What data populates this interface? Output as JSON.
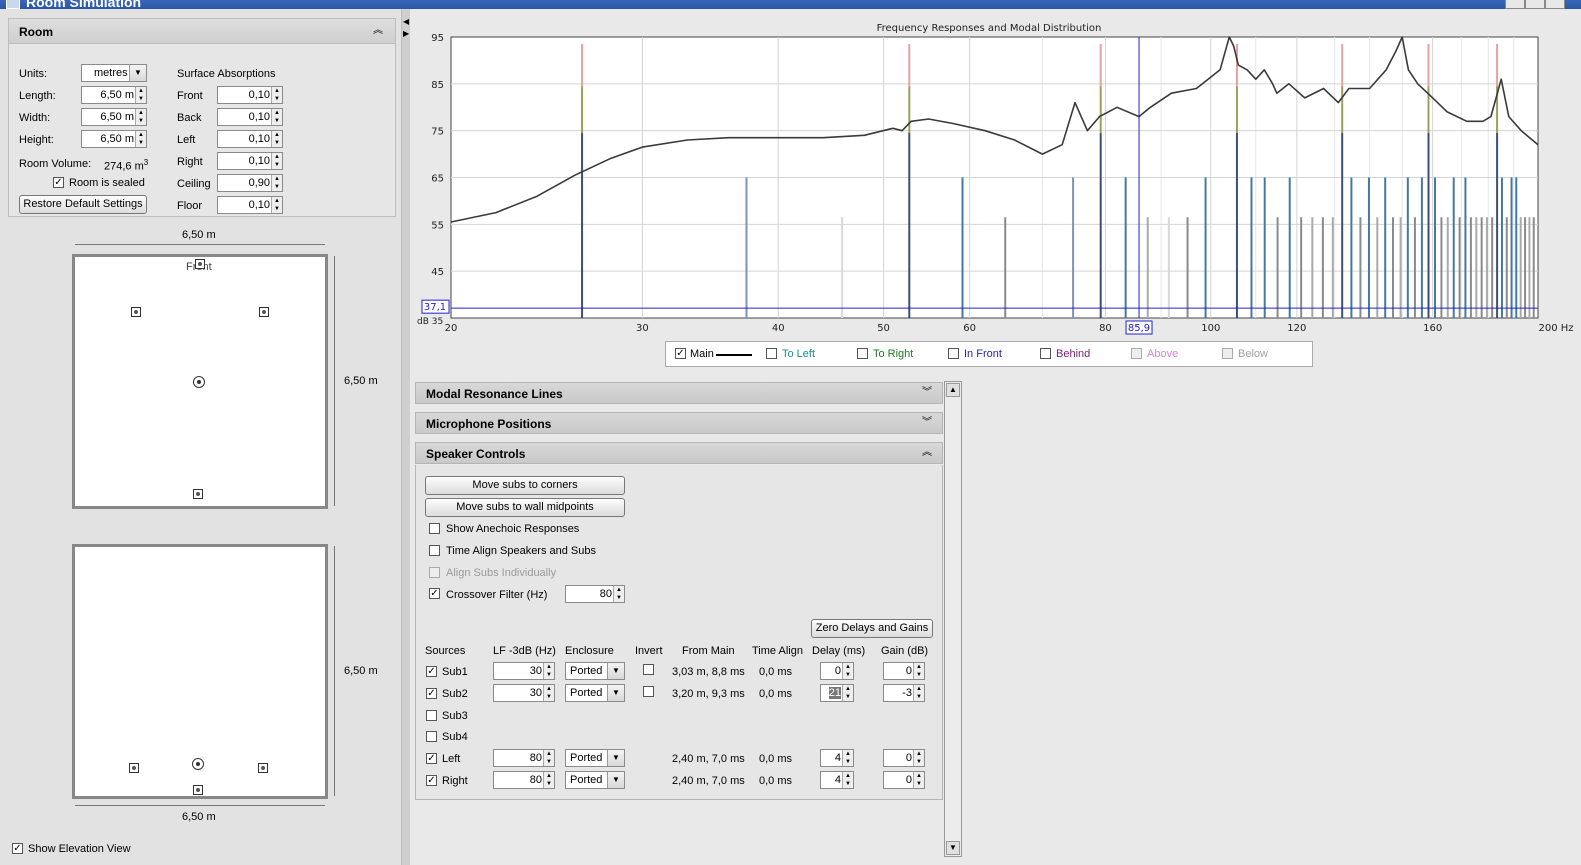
{
  "window": {
    "title": "Room Simulation"
  },
  "room": {
    "header": "Room",
    "units_label": "Units:",
    "units_value": "metres",
    "length_label": "Length:",
    "length_value": "6,50 m",
    "width_label": "Width:",
    "width_value": "6,50 m",
    "height_label": "Height:",
    "height_value": "6,50 m",
    "volume_label": "Room Volume:",
    "volume_value": "274,6 m",
    "volume_sup": "3",
    "sealed_label": "Room is sealed",
    "sealed_checked": "✓",
    "restore_button": "Restore Default Settings",
    "absorptions_header": "Surface Absorptions",
    "absorptions": [
      {
        "label": "Front",
        "value": "0,10"
      },
      {
        "label": "Back",
        "value": "0,10"
      },
      {
        "label": "Left",
        "value": "0,10"
      },
      {
        "label": "Right",
        "value": "0,10"
      },
      {
        "label": "Ceiling",
        "value": "0,90"
      },
      {
        "label": "Floor",
        "value": "0,10"
      }
    ]
  },
  "plan_view": {
    "width_dim": "6,50 m",
    "depth_dim": "6,50 m",
    "front_label": "Front"
  },
  "elevation_view": {
    "height_dim": "6,50 m",
    "width_dim": "6,50 m"
  },
  "show_elevation": {
    "label": "Show Elevation View",
    "checked": "✓"
  },
  "chart_data": {
    "type": "line",
    "title": "Frequency Responses and Modal Distribution",
    "xscale": "log",
    "xlim": [
      20,
      200
    ],
    "ylim": [
      35,
      95
    ],
    "xticks": [
      "20",
      "30",
      "40",
      "50",
      "60",
      "80",
      "100",
      "120",
      "160",
      "200 Hz"
    ],
    "yticks": [
      "95",
      "85",
      "75",
      "65",
      "55",
      "45"
    ],
    "ylabel": "dB 35",
    "cursor": {
      "x": "85,9",
      "y": "37,1"
    },
    "series": [
      {
        "name": "Main",
        "x": [
          20,
          22,
          24,
          26,
          28,
          30,
          33,
          36,
          40,
          44,
          48,
          51,
          52,
          53,
          55,
          58,
          62,
          66,
          70,
          73,
          75,
          77,
          79,
          82,
          85.9,
          88,
          92,
          97,
          102,
          104,
          105,
          106,
          108,
          110,
          112,
          114,
          115,
          118,
          122,
          127,
          131,
          134,
          140,
          145,
          148,
          150,
          152,
          155,
          160,
          165,
          172,
          178,
          181,
          183,
          185,
          188,
          193,
          200
        ],
        "y": [
          55.5,
          57.5,
          61,
          65.5,
          69,
          71.5,
          73,
          73.5,
          73.5,
          73.5,
          74,
          75.5,
          75,
          77,
          77.5,
          76.5,
          75,
          73,
          70,
          72,
          81,
          75,
          78,
          80,
          78,
          80,
          83,
          84,
          88,
          95,
          93,
          89,
          88,
          86,
          88,
          85,
          83,
          85,
          82,
          84,
          81,
          84,
          84,
          88,
          92,
          96,
          88,
          85,
          82,
          79,
          77,
          77,
          78,
          82,
          86,
          78,
          75,
          72
        ]
      }
    ],
    "mode_lines": [
      {
        "f": 26.4,
        "level": 95,
        "color": "#3d4f74"
      },
      {
        "f": 37.4,
        "level": 65,
        "color": "#7d93b8"
      },
      {
        "f": 45.8,
        "level": 56.5,
        "color": "#d8d8d8"
      },
      {
        "f": 52.8,
        "level": 95,
        "color": "#3d4f74"
      },
      {
        "f": 59.1,
        "level": 65,
        "color": "#46799e"
      },
      {
        "f": 64.7,
        "level": 56.5,
        "color": "#8a8a8a"
      },
      {
        "f": 74.7,
        "level": 65,
        "color": "#7d93b8"
      },
      {
        "f": 79.2,
        "level": 95,
        "color": "#3d4f74"
      },
      {
        "f": 83.5,
        "level": 65,
        "color": "#46799e"
      },
      {
        "f": 87.5,
        "level": 56.5,
        "color": "#a9a9a9"
      },
      {
        "f": 91.5,
        "level": 56.5,
        "color": "#d8d8d8"
      },
      {
        "f": 95.2,
        "level": 56.5,
        "color": "#8a8a8a"
      },
      {
        "f": 98.9,
        "level": 65,
        "color": "#46799e"
      },
      {
        "f": 105.7,
        "level": 95,
        "color": "#3d4f74"
      },
      {
        "f": 109.0,
        "level": 65,
        "color": "#46799e"
      },
      {
        "f": 112.1,
        "level": 65,
        "color": "#46799e"
      },
      {
        "f": 115.2,
        "level": 56.5,
        "color": "#8a8a8a"
      },
      {
        "f": 118.2,
        "level": 65,
        "color": "#46799e"
      },
      {
        "f": 121.1,
        "level": 56.5,
        "color": "#8a8a8a"
      },
      {
        "f": 124.0,
        "level": 56.5,
        "color": "#a9a9a9"
      },
      {
        "f": 126.8,
        "level": 56.5,
        "color": "#8a8a8a"
      },
      {
        "f": 129.5,
        "level": 56.5,
        "color": "#a9a9a9"
      },
      {
        "f": 132.1,
        "level": 95,
        "color": "#3d4f74"
      },
      {
        "f": 134.7,
        "level": 65,
        "color": "#46799e"
      },
      {
        "f": 137.3,
        "level": 56.5,
        "color": "#8a8a8a"
      },
      {
        "f": 139.8,
        "level": 65,
        "color": "#46799e"
      },
      {
        "f": 142.3,
        "level": 56.5,
        "color": "#a9a9a9"
      },
      {
        "f": 144.7,
        "level": 65,
        "color": "#46799e"
      },
      {
        "f": 147.1,
        "level": 56.5,
        "color": "#8a8a8a"
      },
      {
        "f": 149.5,
        "level": 56.5,
        "color": "#a9a9a9"
      },
      {
        "f": 151.8,
        "level": 65,
        "color": "#46799e"
      },
      {
        "f": 154.1,
        "level": 56.5,
        "color": "#8a8a8a"
      },
      {
        "f": 156.4,
        "level": 65,
        "color": "#46799e"
      },
      {
        "f": 158.6,
        "level": 95,
        "color": "#3d4f74"
      },
      {
        "f": 160.8,
        "level": 65,
        "color": "#46799e"
      },
      {
        "f": 163.0,
        "level": 56.5,
        "color": "#8a8a8a"
      },
      {
        "f": 165.2,
        "level": 56.5,
        "color": "#a9a9a9"
      },
      {
        "f": 167.3,
        "level": 65,
        "color": "#46799e"
      },
      {
        "f": 169.4,
        "level": 56.5,
        "color": "#8a8a8a"
      },
      {
        "f": 171.5,
        "level": 65,
        "color": "#46799e"
      },
      {
        "f": 173.5,
        "level": 56.5,
        "color": "#8a8a8a"
      },
      {
        "f": 175.5,
        "level": 56.5,
        "color": "#a9a9a9"
      },
      {
        "f": 177.5,
        "level": 56.5,
        "color": "#8a8a8a"
      },
      {
        "f": 179.5,
        "level": 56.5,
        "color": "#a9a9a9"
      },
      {
        "f": 181.5,
        "level": 56.5,
        "color": "#8a8a8a"
      },
      {
        "f": 183.4,
        "level": 95,
        "color": "#3d4f74"
      },
      {
        "f": 185.3,
        "level": 65,
        "color": "#46799e"
      },
      {
        "f": 187.2,
        "level": 56.5,
        "color": "#8a8a8a"
      },
      {
        "f": 189.1,
        "level": 65,
        "color": "#46799e"
      },
      {
        "f": 191.0,
        "level": 65,
        "color": "#46799e"
      },
      {
        "f": 192.8,
        "level": 56.5,
        "color": "#a9a9a9"
      },
      {
        "f": 194.6,
        "level": 56.5,
        "color": "#8a8a8a"
      },
      {
        "f": 196.4,
        "level": 56.5,
        "color": "#a9a9a9"
      },
      {
        "f": 198.2,
        "level": 56.5,
        "color": "#8a8a8a"
      }
    ]
  },
  "legend": [
    {
      "label": "Main",
      "checked": "✓",
      "color": "#000000"
    },
    {
      "label": "To Left",
      "checked": "",
      "color": "#1a8f8a"
    },
    {
      "label": "To Right",
      "checked": "",
      "color": "#1c7a1c"
    },
    {
      "label": "In Front",
      "checked": "",
      "color": "#1c1ccc"
    },
    {
      "label": "Behind",
      "checked": "",
      "color": "#7a1c7a"
    },
    {
      "label": "Above",
      "checked": "",
      "color": "#e080e0"
    },
    {
      "label": "Below",
      "checked": "",
      "color": "#a0a0a0"
    }
  ],
  "sections": {
    "modal": "Modal Resonance Lines",
    "mics": "Microphone Positions",
    "speakers": "Speaker Controls"
  },
  "speaker_controls": {
    "move_corners": "Move subs to corners",
    "move_midpoints": "Move subs to wall midpoints",
    "show_anechoic": "Show Anechoic Responses",
    "time_align": "Time Align Speakers and Subs",
    "align_subs": "Align Subs Individually",
    "crossover": "Crossover Filter (Hz)",
    "crossover_checked": "✓",
    "crossover_value": "80",
    "zero_button": "Zero Delays and Gains",
    "headers": [
      "Sources",
      "LF -3dB (Hz)",
      "Enclosure",
      "Invert",
      "From Main",
      "Time Align",
      "Delay (ms)",
      "Gain (dB)"
    ],
    "rows": [
      {
        "name": "Sub1",
        "checked": "✓",
        "lf": "30",
        "enclosure": "Ported",
        "invert": true,
        "from_main": "3,03 m, 8,8 ms",
        "time_align": "0,0 ms",
        "delay": "0",
        "gain": "0",
        "active": true
      },
      {
        "name": "Sub2",
        "checked": "✓",
        "lf": "30",
        "enclosure": "Ported",
        "invert": true,
        "from_main": "3,20 m, 9,3 ms",
        "time_align": "0,0 ms",
        "delay": "21",
        "gain": "-3",
        "active": true
      },
      {
        "name": "Sub3",
        "checked": "",
        "active": false
      },
      {
        "name": "Sub4",
        "checked": "",
        "active": false
      },
      {
        "name": "Left",
        "checked": "✓",
        "lf": "80",
        "enclosure": "Ported",
        "invert": false,
        "from_main": "2,40 m, 7,0 ms",
        "time_align": "0,0 ms",
        "delay": "4",
        "gain": "0",
        "active": true
      },
      {
        "name": "Right",
        "checked": "✓",
        "lf": "80",
        "enclosure": "Ported",
        "invert": false,
        "from_main": "2,40 m, 7,0 ms",
        "time_align": "0,0 ms",
        "delay": "4",
        "gain": "0",
        "active": true
      }
    ]
  }
}
